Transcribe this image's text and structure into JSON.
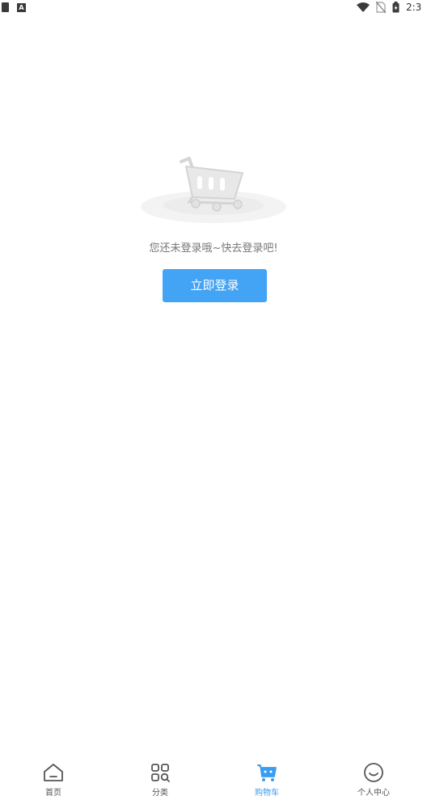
{
  "status_bar": {
    "time": "2:3",
    "icons": [
      "phone-icon",
      "a-icon",
      "wifi-icon",
      "no-sim-icon",
      "battery-icon"
    ]
  },
  "empty_cart": {
    "illustration": "shopping-cart-illustration",
    "hint": "您还未登录哦~快去登录吧!",
    "login_button": "立即登录"
  },
  "tabs": [
    {
      "label": "首页",
      "icon": "home-icon",
      "active": false
    },
    {
      "label": "分类",
      "icon": "category-icon",
      "active": false
    },
    {
      "label": "购物车",
      "icon": "cart-icon",
      "active": true
    },
    {
      "label": "个人中心",
      "icon": "profile-icon",
      "active": false
    }
  ],
  "colors": {
    "accent": "#43a3f5",
    "tab_active": "#3a9df0",
    "hint_text": "#777777"
  }
}
